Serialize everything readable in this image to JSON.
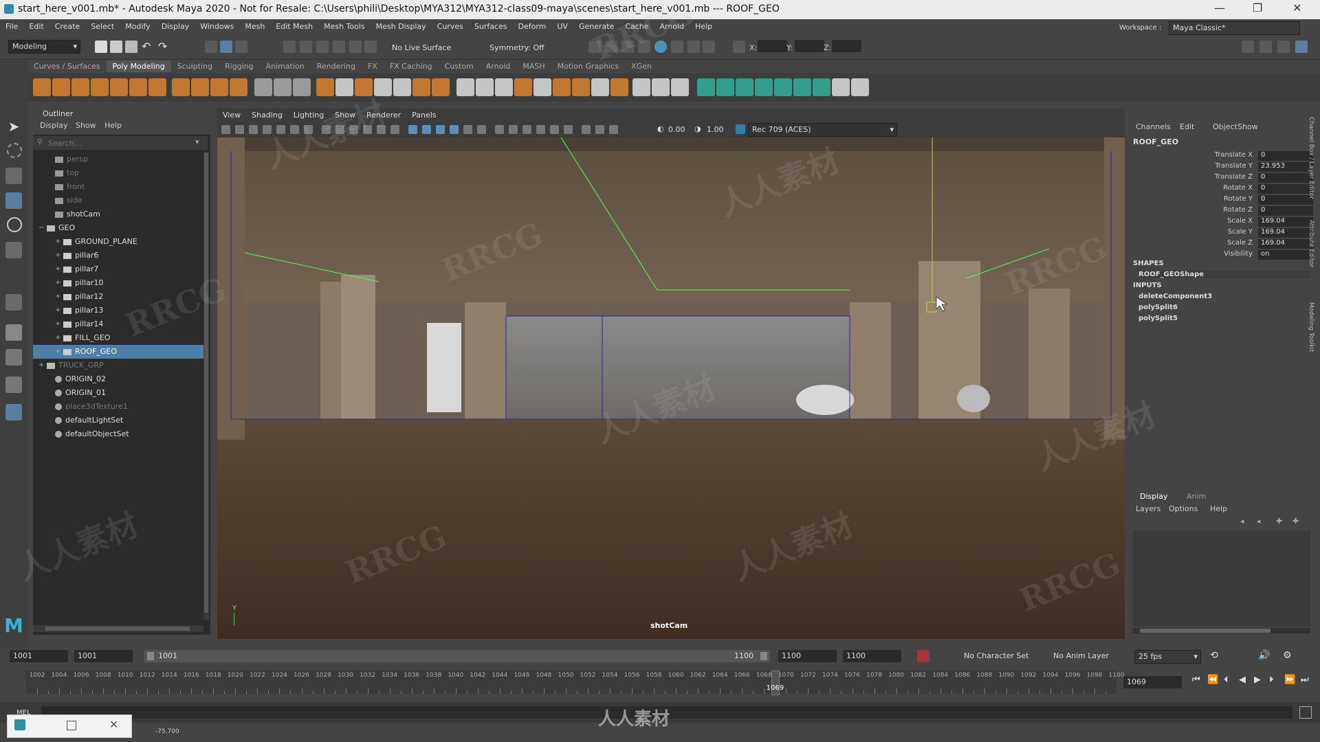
{
  "window": {
    "title": "start_here_v001.mb* - Autodesk Maya 2020 - Not for Resale: C:\\Users\\phili\\Desktop\\MYA312\\MYA312-class09-maya\\scenes\\start_here_v001.mb   ---   ROOF_GEO",
    "minimize": "—",
    "maximize": "❐",
    "close": "✕"
  },
  "menubar": [
    "File",
    "Edit",
    "Create",
    "Select",
    "Modify",
    "Display",
    "Windows",
    "Mesh",
    "Edit Mesh",
    "Mesh Tools",
    "Mesh Display",
    "Curves",
    "Surfaces",
    "Deform",
    "UV",
    "Generate",
    "Cache",
    "Arnold",
    "Help"
  ],
  "statusline": {
    "mode": "Modeling",
    "live_surface": "No Live Surface",
    "symmetry": "Symmetry: Off",
    "x_label": "X:",
    "y_label": "Y:",
    "z_label": "Z:",
    "workspace_label": "Workspace :",
    "workspace": "Maya Classic*"
  },
  "shelf_tabs": [
    "Curves / Surfaces",
    "Poly Modeling",
    "Sculpting",
    "Rigging",
    "Animation",
    "Rendering",
    "FX",
    "FX Caching",
    "Custom",
    "Arnold",
    "MASH",
    "Motion Graphics",
    "XGen"
  ],
  "shelf_active": "Poly Modeling",
  "outliner": {
    "title": "Outliner",
    "menu": [
      "Display",
      "Show",
      "Help"
    ],
    "search_placeholder": "Search...",
    "items": [
      {
        "label": "persp",
        "indent": 1,
        "type": "camera",
        "dim": true
      },
      {
        "label": "top",
        "indent": 1,
        "type": "camera",
        "dim": true
      },
      {
        "label": "front",
        "indent": 1,
        "type": "camera",
        "dim": true
      },
      {
        "label": "side",
        "indent": 1,
        "type": "camera",
        "dim": true
      },
      {
        "label": "shotCam",
        "indent": 1,
        "type": "camera",
        "dim": false
      },
      {
        "label": "GEO",
        "indent": 0,
        "type": "group",
        "dim": false,
        "expand": "−"
      },
      {
        "label": "GROUND_PLANE",
        "indent": 2,
        "type": "mesh",
        "dim": false,
        "expand": "+"
      },
      {
        "label": "pillar6",
        "indent": 2,
        "type": "mesh",
        "dim": false,
        "expand": "+"
      },
      {
        "label": "pillar7",
        "indent": 2,
        "type": "mesh",
        "dim": false,
        "expand": "+"
      },
      {
        "label": "pillar10",
        "indent": 2,
        "type": "mesh",
        "dim": false,
        "expand": "+"
      },
      {
        "label": "pillar12",
        "indent": 2,
        "type": "mesh",
        "dim": false,
        "expand": "+"
      },
      {
        "label": "pillar13",
        "indent": 2,
        "type": "mesh",
        "dim": false,
        "expand": "+"
      },
      {
        "label": "pillar14",
        "indent": 2,
        "type": "mesh",
        "dim": false,
        "expand": "+"
      },
      {
        "label": "FILL_GEO",
        "indent": 2,
        "type": "mesh",
        "dim": false,
        "expand": "+"
      },
      {
        "label": "ROOF_GEO",
        "indent": 2,
        "type": "mesh",
        "dim": false,
        "selected": true,
        "expand": "+"
      },
      {
        "label": "TRUCK_GRP",
        "indent": 0,
        "type": "group",
        "dim": true,
        "expand": "+"
      },
      {
        "label": "ORIGIN_02",
        "indent": 1,
        "type": "locator",
        "dim": false
      },
      {
        "label": "ORIGIN_01",
        "indent": 1,
        "type": "locator",
        "dim": false
      },
      {
        "label": "place3dTexture1",
        "indent": 1,
        "type": "locator",
        "dim": true
      },
      {
        "label": "defaultLightSet",
        "indent": 1,
        "type": "set",
        "dim": false
      },
      {
        "label": "defaultObjectSet",
        "indent": 1,
        "type": "set",
        "dim": false
      }
    ]
  },
  "viewport": {
    "menu": [
      "View",
      "Shading",
      "Lighting",
      "Show",
      "Renderer",
      "Panels"
    ],
    "exposure": "0.00",
    "gamma": "1.00",
    "colorspace": "Rec 709 (ACES)",
    "camera_label": "shotCam",
    "axis_y": "Y"
  },
  "channelbox": {
    "menu": [
      "Channels",
      "Edit",
      "Object",
      "Show"
    ],
    "object": "ROOF_GEO",
    "channels": [
      {
        "name": "Translate X",
        "value": "0"
      },
      {
        "name": "Translate Y",
        "value": "23.953"
      },
      {
        "name": "Translate Z",
        "value": "0"
      },
      {
        "name": "Rotate X",
        "value": "0"
      },
      {
        "name": "Rotate Y",
        "value": "0"
      },
      {
        "name": "Rotate Z",
        "value": "0"
      },
      {
        "name": "Scale X",
        "value": "169.04"
      },
      {
        "name": "Scale Y",
        "value": "169.04"
      },
      {
        "name": "Scale Z",
        "value": "169.04"
      },
      {
        "name": "Visibility",
        "value": "on"
      }
    ],
    "shapes_header": "SHAPES",
    "shapes": [
      "ROOF_GEOShape"
    ],
    "inputs_header": "INPUTS",
    "inputs": [
      "deleteComponent3",
      "polySplit6",
      "polySplit5"
    ],
    "side_tabs": [
      "Channel Box / Layer Editor",
      "Attribute Editor",
      "Modeling Toolkit"
    ]
  },
  "layers": {
    "tabs": [
      "Display",
      "Anim"
    ],
    "menu": [
      "Layers",
      "Options",
      "Help"
    ]
  },
  "timebar": {
    "range_start": "1001",
    "playback_start": "1001",
    "slider_start": "1001",
    "slider_end": "1100",
    "playback_end": "1100",
    "range_end": "1100",
    "character_set": "No Character Set",
    "anim_layer": "No Anim Layer",
    "fps": "25 fps"
  },
  "timeline": {
    "ticks": [
      "1002",
      "1004",
      "1006",
      "1008",
      "1010",
      "1012",
      "1014",
      "1016",
      "1018",
      "1020",
      "1022",
      "1024",
      "1026",
      "1028",
      "1030",
      "1032",
      "1034",
      "1036",
      "1038",
      "1040",
      "1042",
      "1044",
      "1046",
      "1048",
      "1050",
      "1052",
      "1054",
      "1056",
      "1058",
      "1060",
      "1062",
      "1064",
      "1066",
      "1068",
      "1070",
      "1072",
      "1074",
      "1076",
      "1078",
      "1080",
      "1082",
      "1084",
      "1086",
      "1088",
      "1090",
      "1092",
      "1094",
      "1096",
      "1098",
      "1100"
    ],
    "current_frame": "1069",
    "current_frame_field": "1069",
    "range_start_frame": 1001,
    "range_end_frame": 1100,
    "playhead_frame": 1069
  },
  "cmdline": {
    "mode": "MEL",
    "coord": "-75.700"
  },
  "watermark": {
    "brand": "RRCG",
    "cn": "人人素材"
  },
  "colors": {
    "selection": "#4d7fab",
    "panel": "#444444",
    "field": "#2b2b2b",
    "wire_green": "#4cff4c",
    "wire_blue": "#2a2a9a"
  }
}
